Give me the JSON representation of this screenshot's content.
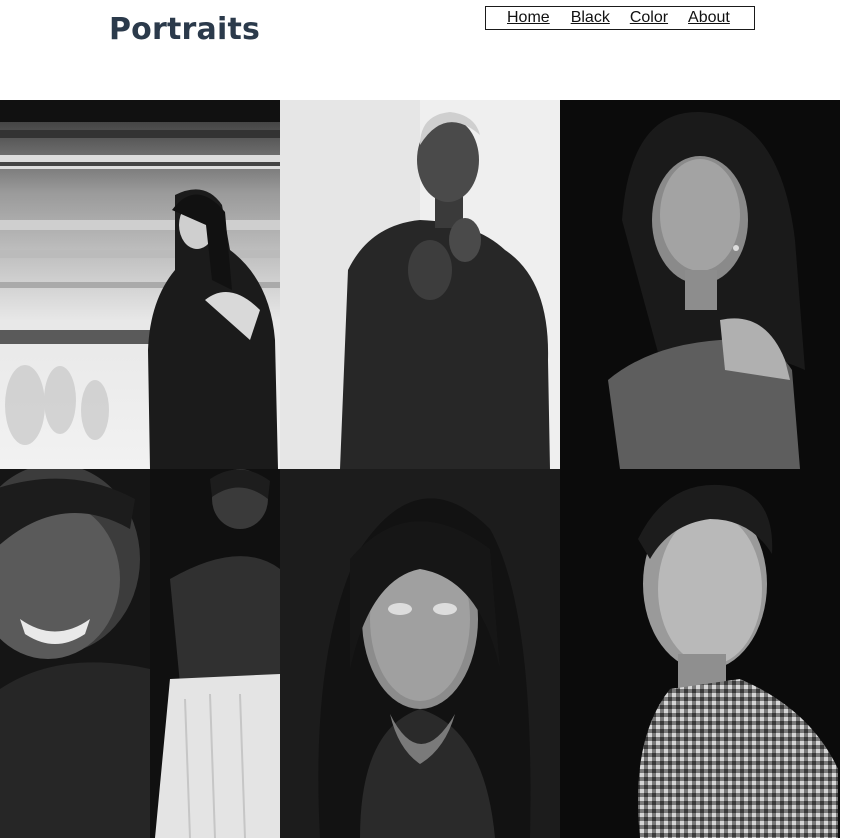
{
  "site": {
    "title": "Portraits"
  },
  "nav": {
    "items": [
      {
        "label": "Home"
      },
      {
        "label": "Black"
      },
      {
        "label": "Color"
      },
      {
        "label": "About"
      }
    ]
  },
  "gallery": {
    "tiles": [
      {
        "subject": "woman-leather-jacket-under-bridge"
      },
      {
        "subject": "woman-shaved-head-knit-sweater"
      },
      {
        "subject": "woman-off-shoulder-dark-background"
      },
      {
        "subject": "smiling-woman-and-standing-woman-split"
      },
      {
        "subject": "woman-statement-necklace"
      },
      {
        "subject": "young-man-checked-shirt"
      }
    ]
  }
}
